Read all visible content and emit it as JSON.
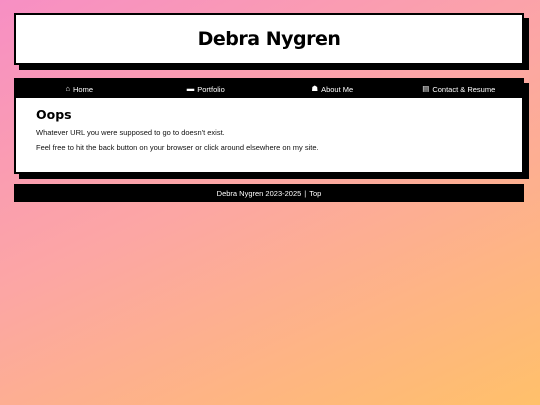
{
  "site": {
    "title": "Debra Nygren"
  },
  "nav": {
    "items": [
      {
        "label": "Home",
        "icon": "home-icon",
        "glyph": "⌂"
      },
      {
        "label": "Portfolio",
        "icon": "folder-icon",
        "glyph": "▬"
      },
      {
        "label": "About Me",
        "icon": "user-icon",
        "glyph": "☗"
      },
      {
        "label": "Contact & Resume",
        "icon": "file-icon",
        "glyph": "▤"
      }
    ]
  },
  "main": {
    "heading": "Oops",
    "paragraphs": [
      "Whatever URL you were supposed to go to doesn't exist.",
      "Feel free to hit the back button on your browser or click around elsewhere on my site."
    ]
  },
  "footer": {
    "copyright": "Debra Nygren 2023-2025",
    "separator": "|",
    "top_link": "Top"
  }
}
